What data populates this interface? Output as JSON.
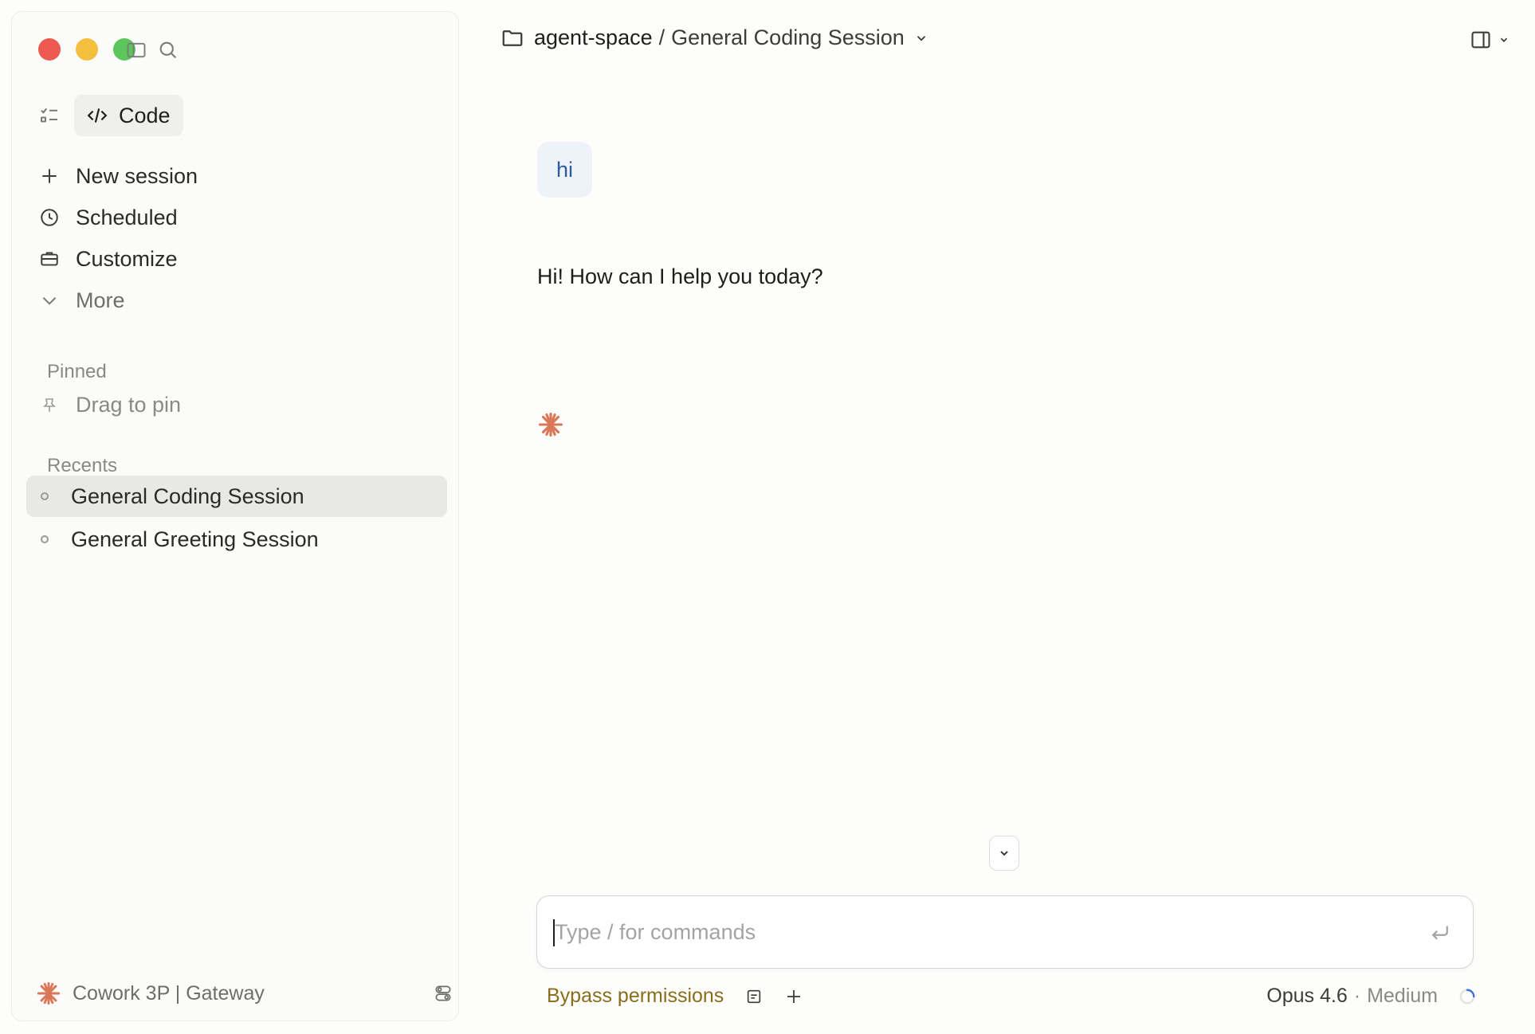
{
  "sidebar": {
    "mode_label": "Code",
    "nav": [
      {
        "label": "New session",
        "icon": "plus-icon"
      },
      {
        "label": "Scheduled",
        "icon": "clock-icon"
      },
      {
        "label": "Customize",
        "icon": "briefcase-icon"
      },
      {
        "label": "More",
        "icon": "chevron-down-icon"
      }
    ],
    "pinned_title": "Pinned",
    "pin_hint": "Drag to pin",
    "recents_title": "Recents",
    "recents": [
      {
        "label": "General Coding Session",
        "active": true
      },
      {
        "label": "General Greeting Session",
        "active": false
      }
    ],
    "footer_label": "Cowork 3P | Gateway"
  },
  "header": {
    "project": "agent-space",
    "separator": "/",
    "session": "General Coding Session"
  },
  "conversation": {
    "user_message": "hi",
    "assistant_message": "Hi! How can I help you today?"
  },
  "composer": {
    "placeholder": "Type / for commands",
    "value": ""
  },
  "toolbar": {
    "permissions_label": "Bypass permissions",
    "model": "Opus 4.6",
    "effort_separator": "·",
    "effort": "Medium"
  },
  "colors": {
    "accent": "#d97757",
    "bypass": "#8a6d1a",
    "user_bubble_bg": "#eef3fa",
    "user_bubble_text": "#2d5c9a"
  }
}
